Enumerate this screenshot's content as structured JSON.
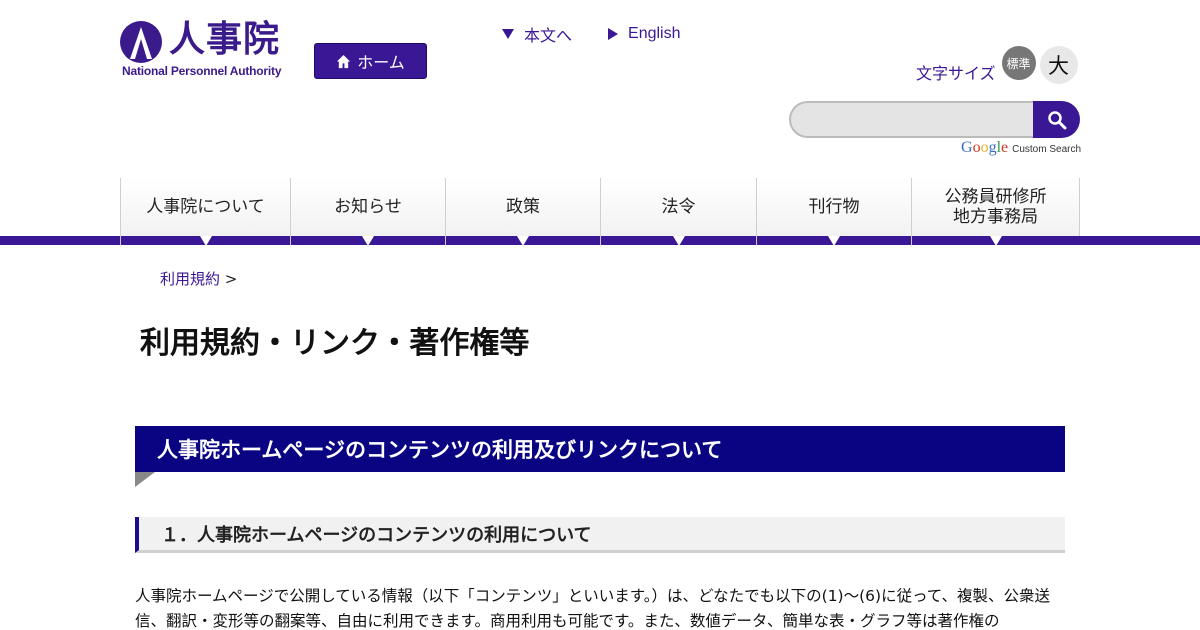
{
  "header": {
    "logo_kanji": "人事院",
    "logo_english": "National Personnel Authority",
    "home_label": "ホーム",
    "skip_link": "本文へ",
    "english_link": "English",
    "font_size_label": "文字サイズ",
    "font_standard": "標準",
    "font_large": "大",
    "search_placeholder": "",
    "google_letters": [
      "G",
      "o",
      "o",
      "g",
      "l",
      "e"
    ],
    "custom_search": "Custom Search"
  },
  "nav": {
    "items": [
      {
        "label": "人事院について"
      },
      {
        "label": "お知らせ"
      },
      {
        "label": "政策"
      },
      {
        "label": "法令"
      },
      {
        "label": "刊行物"
      },
      {
        "label": "公務員研修所\n地方事務局"
      }
    ]
  },
  "breadcrumb": {
    "link": "利用規約",
    "separator": ">"
  },
  "main": {
    "page_title": "利用規約・リンク・著作権等",
    "section_heading": "人事院ホームページのコンテンツの利用及びリンクについて",
    "subsection_heading": "１．人事院ホームページのコンテンツの利用について",
    "paragraph": "人事院ホームページで公開している情報（以下「コンテンツ」といいます。）は、どなたでも以下の(1)～(6)に従って、複製、公衆送信、翻訳・変形等の翻案等、自由に利用できます。商用利用も可能です。また、数値データ、簡単な表・グラフ等は著作権の"
  },
  "colors": {
    "brand": "#3a1795",
    "heading_bg": "#0a0382"
  }
}
